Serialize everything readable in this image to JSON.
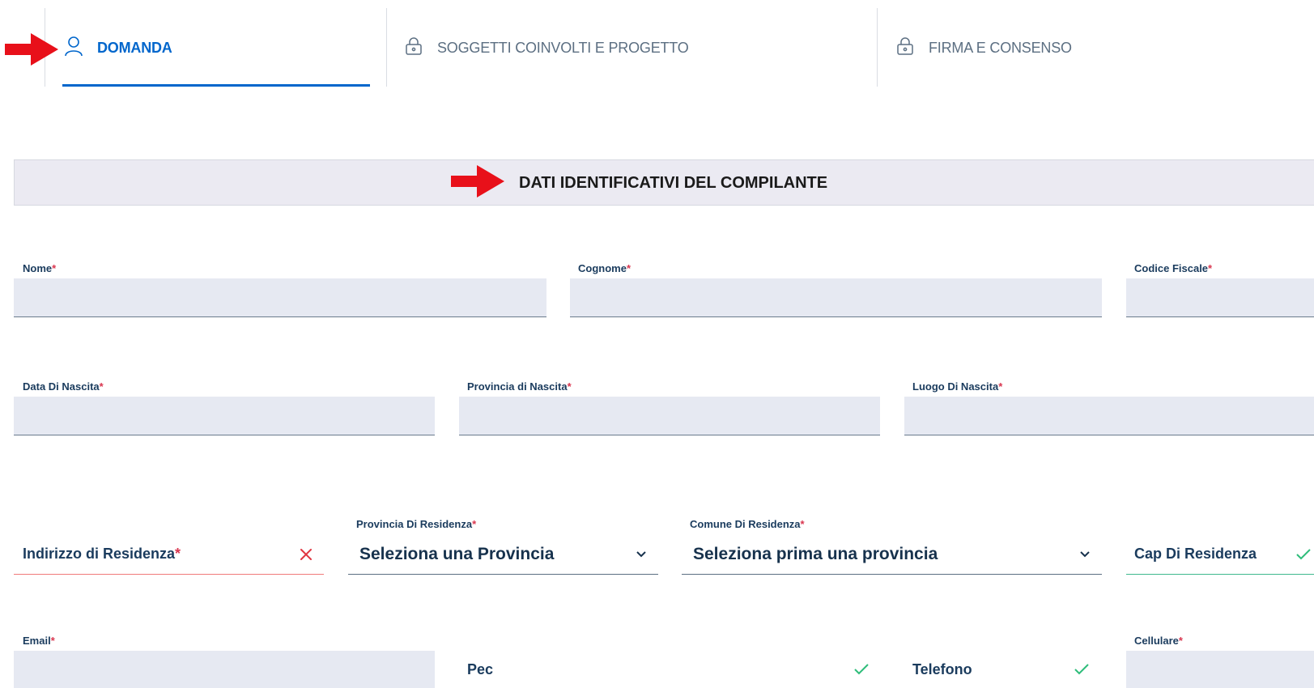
{
  "tabs": [
    {
      "label": "DOMANDA",
      "icon": "user-icon",
      "state": "active"
    },
    {
      "label": "SOGGETTI COINVOLTI E PROGETTO",
      "icon": "lock-icon",
      "state": "locked"
    },
    {
      "label": "FIRMA E CONSENSO",
      "icon": "lock-icon",
      "state": "locked"
    }
  ],
  "section": {
    "title": "DATI IDENTIFICATIVI DEL COMPILANTE"
  },
  "required_mark": "*",
  "fields": {
    "nome": {
      "label": "Nome",
      "value": ""
    },
    "cognome": {
      "label": "Cognome",
      "value": ""
    },
    "codice_fiscale": {
      "label": "Codice Fiscale",
      "value": ""
    },
    "data_nascita": {
      "label": "Data Di Nascita",
      "value": ""
    },
    "provincia_nascita": {
      "label": "Provincia di Nascita",
      "value": ""
    },
    "luogo_nascita": {
      "label": "Luogo Di Nascita",
      "value": ""
    },
    "indirizzo_residenza": {
      "label": "Indirizzo di Residenza",
      "status": "invalid"
    },
    "provincia_residenza": {
      "label": "Provincia Di Residenza",
      "value": "Seleziona una Provincia"
    },
    "comune_residenza": {
      "label": "Comune Di Residenza",
      "value": "Seleziona prima una provincia"
    },
    "cap_residenza": {
      "label": "Cap Di Residenza",
      "status": "valid"
    },
    "email": {
      "label": "Email",
      "value": ""
    },
    "pec": {
      "label": "Pec",
      "status": "valid"
    },
    "telefono": {
      "label": "Telefono",
      "status": "valid"
    },
    "cellulare": {
      "label": "Cellulare",
      "value": ""
    }
  },
  "colors": {
    "accent": "#0066cc",
    "required": "#d9364f",
    "error": "#e0343f",
    "success": "#2ebd7a",
    "annotation_arrow": "#e8101a",
    "input_bg": "#e6e9f2"
  }
}
